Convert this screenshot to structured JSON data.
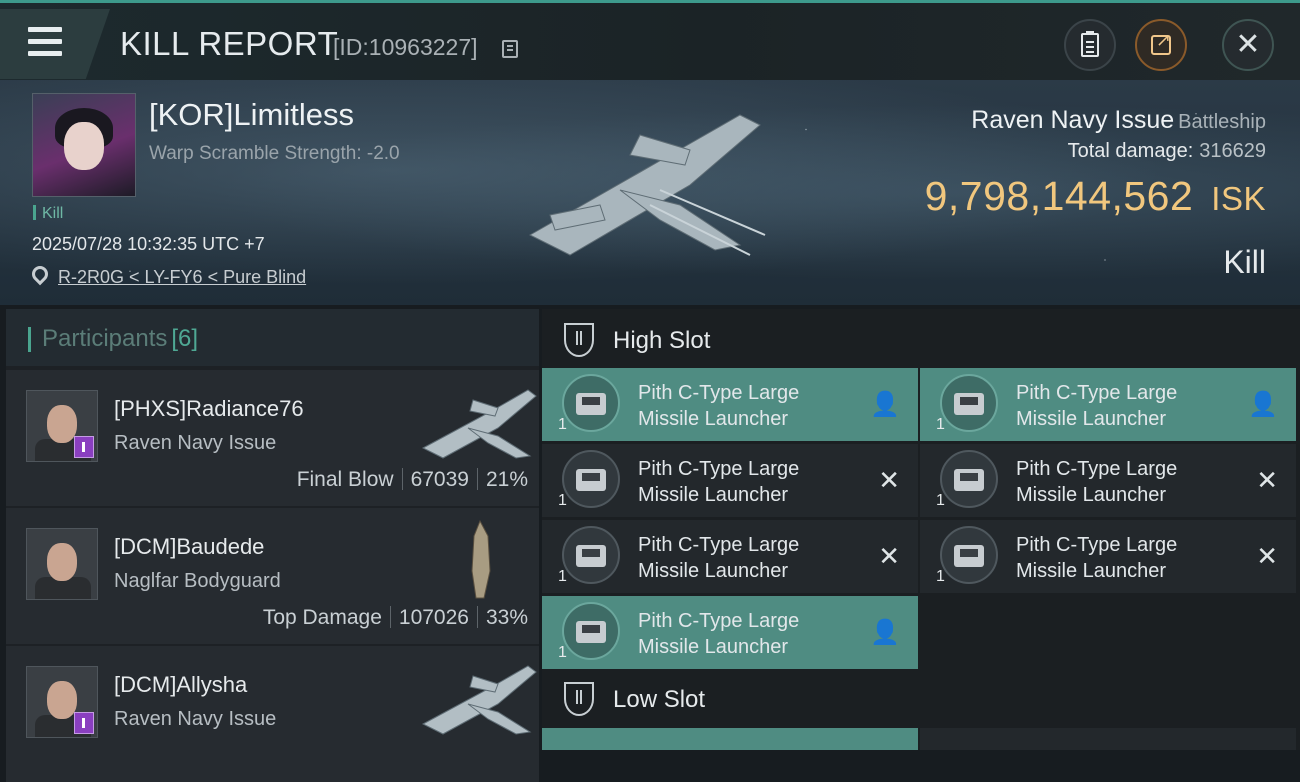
{
  "header": {
    "title": "KILL REPORT",
    "report_id": "[ID:10963227]",
    "icons": [
      "menu-icon",
      "copy-icon",
      "clipboard-icon",
      "share-icon",
      "close-icon"
    ]
  },
  "victim": {
    "name": "[KOR]Limitless",
    "warp_scramble": "Warp Scramble Strength: -2.0",
    "tag": "Kill",
    "timestamp": "2025/07/28 10:32:35 UTC +7",
    "location": "R-2R0G < LY-FY6 < Pure Blind",
    "ship_name": "Raven Navy Issue",
    "ship_class": "Battleship",
    "total_damage_label": "Total damage:",
    "total_damage": "316629",
    "isk_value": "9,798,144,562",
    "isk_unit": "ISK",
    "result": "Kill"
  },
  "participants": {
    "title": "Participants",
    "count": "[6]",
    "rows": [
      {
        "name": "[PHXS]Radiance76",
        "ship": "Raven Navy Issue",
        "label": "Final Blow",
        "damage": "67039",
        "percent": "21%"
      },
      {
        "name": "[DCM]Baudede",
        "ship": "Naglfar Bodyguard",
        "label": "Top Damage",
        "damage": "107026",
        "percent": "33%"
      },
      {
        "name": "[DCM]Allysha",
        "ship": "Raven Navy Issue",
        "label": "",
        "damage": "",
        "percent": ""
      }
    ]
  },
  "fitting": {
    "high_slot_title": "High Slot",
    "low_slot_title": "Low Slot",
    "modules": [
      {
        "line1": "Pith C-Type Large",
        "line2": "Missile Launcher",
        "qty": "1",
        "status": "person-icon"
      },
      {
        "line1": "Pith C-Type Large",
        "line2": "Missile Launcher",
        "qty": "1",
        "status": "person-icon"
      },
      {
        "line1": "Pith C-Type Large",
        "line2": "Missile Launcher",
        "qty": "1",
        "status": "destroyed-x-icon"
      },
      {
        "line1": "Pith C-Type Large",
        "line2": "Missile Launcher",
        "qty": "1",
        "status": "destroyed-x-icon"
      },
      {
        "line1": "Pith C-Type Large",
        "line2": "Missile Launcher",
        "qty": "1",
        "status": "destroyed-x-icon"
      },
      {
        "line1": "Pith C-Type Large",
        "line2": "Missile Launcher",
        "qty": "1",
        "status": "destroyed-x-icon"
      },
      {
        "line1": "Pith C-Type Large",
        "line2": "Missile Launcher",
        "qty": "1",
        "status": "person-icon"
      }
    ]
  },
  "colors": {
    "accent_teal": "#4aa58f",
    "isk_gold": "#f1c77e",
    "active_module": "#4f8c82",
    "share_orange": "#8a5a2a"
  }
}
